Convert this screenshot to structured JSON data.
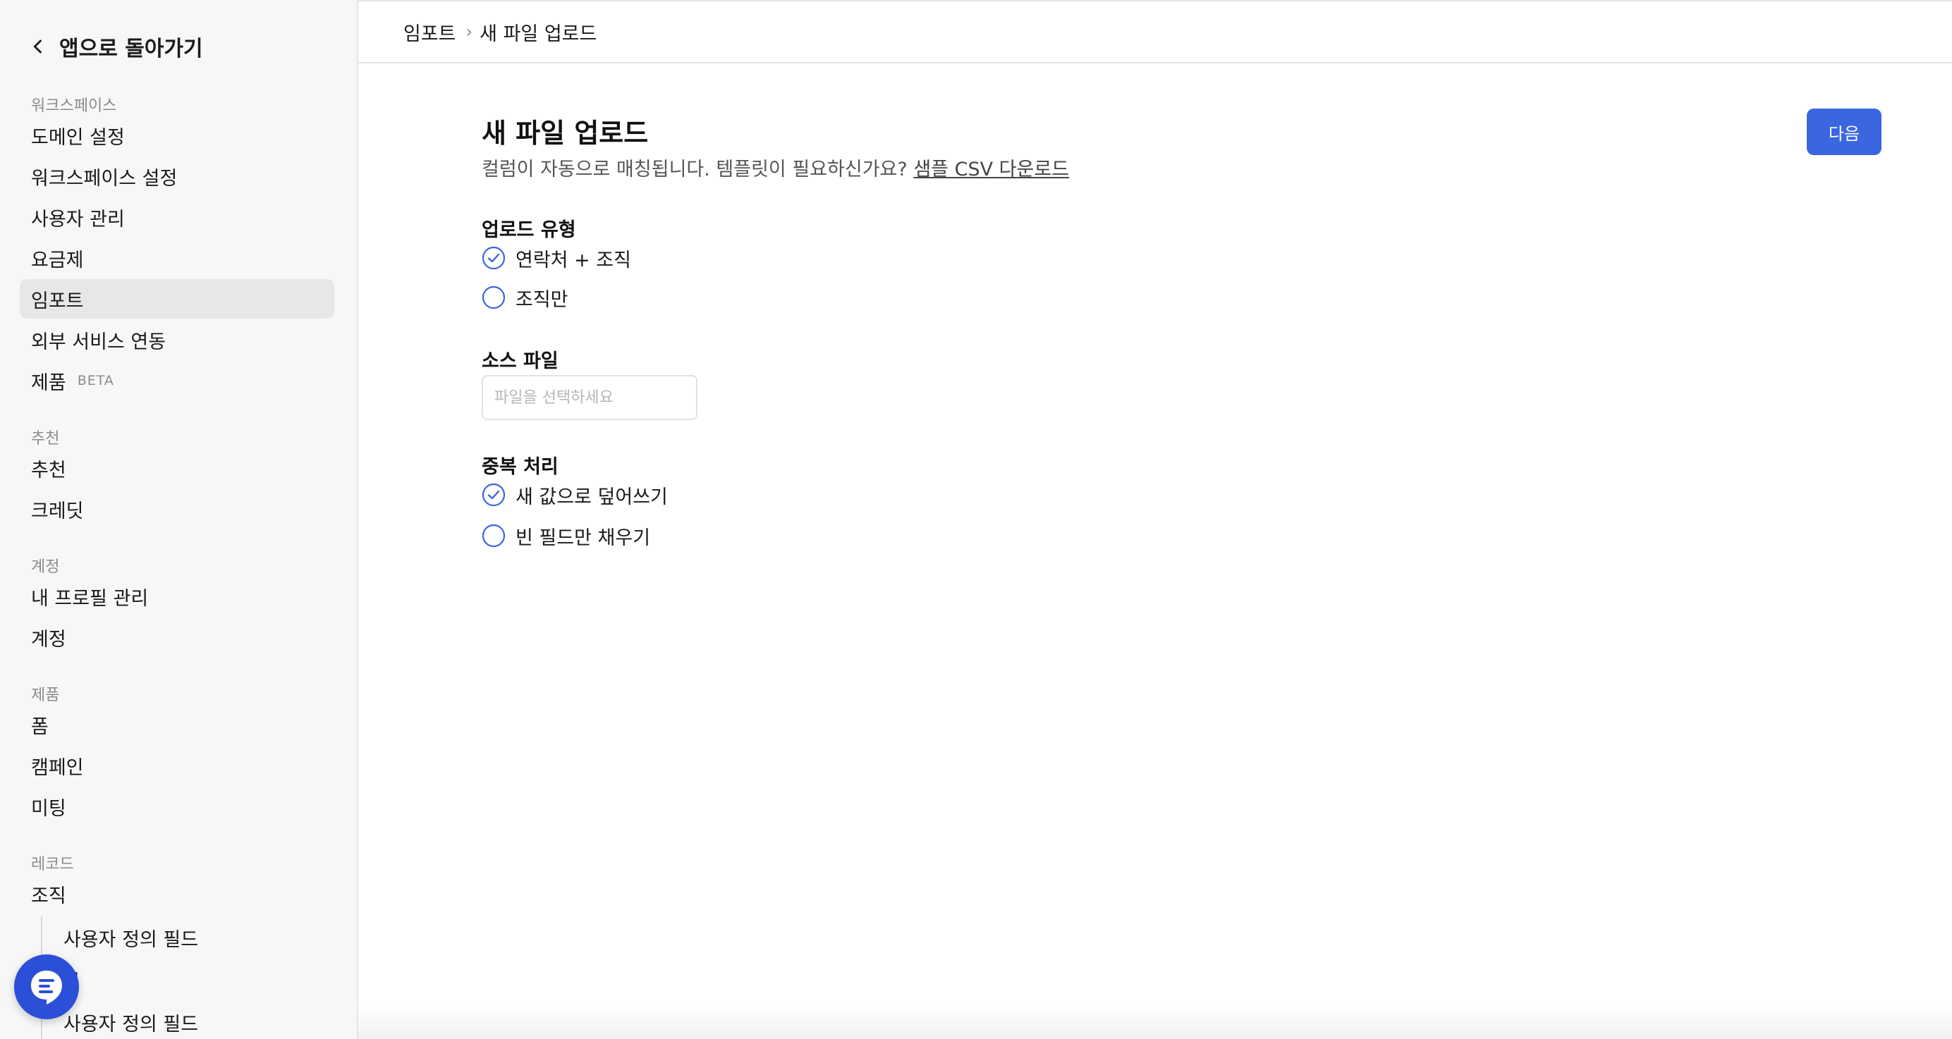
{
  "sidebar": {
    "back_label": "앱으로 돌아가기",
    "sections": {
      "workspace": "워크스페이스",
      "referral": "추천",
      "account": "계정",
      "product": "제품",
      "records": "레코드"
    },
    "items": {
      "domain": "도메인 설정",
      "workspace_settings": "워크스페이스 설정",
      "users": "사용자 관리",
      "billing": "요금제",
      "import": "임포트",
      "integrations": "외부 서비스 연동",
      "products": "제품",
      "products_badge": "BETA",
      "referral": "추천",
      "credit": "크레딧",
      "profile": "내 프로필 관리",
      "account": "계정",
      "form": "폼",
      "campaign": "캠페인",
      "meeting": "미팅",
      "organization": "조직",
      "org_custom_fields": "사용자 정의 필드",
      "contact_partial": "처",
      "contact_custom_fields": "사용자 정의 필드"
    }
  },
  "breadcrumb": {
    "parent": "임포트",
    "separator": "›",
    "current": "새 파일 업로드"
  },
  "main": {
    "title": "새 파일 업로드",
    "subtitle": "컬럼이 자동으로 매칭됩니다. 템플릿이 필요하신가요?",
    "sample_link": "샘플 CSV 다운로드",
    "next_label": "다음",
    "upload_type": {
      "label": "업로드 유형",
      "options": [
        {
          "label": "연락처 + 조직",
          "checked": true
        },
        {
          "label": "조직만",
          "checked": false
        }
      ]
    },
    "source_file": {
      "label": "소스 파일",
      "placeholder": "파일을 선택하세요",
      "value": ""
    },
    "dedupe": {
      "label": "중복 처리",
      "options": [
        {
          "label": "새 값으로 덮어쓰기",
          "checked": true
        },
        {
          "label": "빈 필드만 채우기",
          "checked": false
        }
      ]
    }
  },
  "colors": {
    "accent": "#3a66e0",
    "chat_fab": "#2c4fd8",
    "sidebar_bg": "#f7f7f8",
    "active_bg": "#e7e7ea"
  }
}
